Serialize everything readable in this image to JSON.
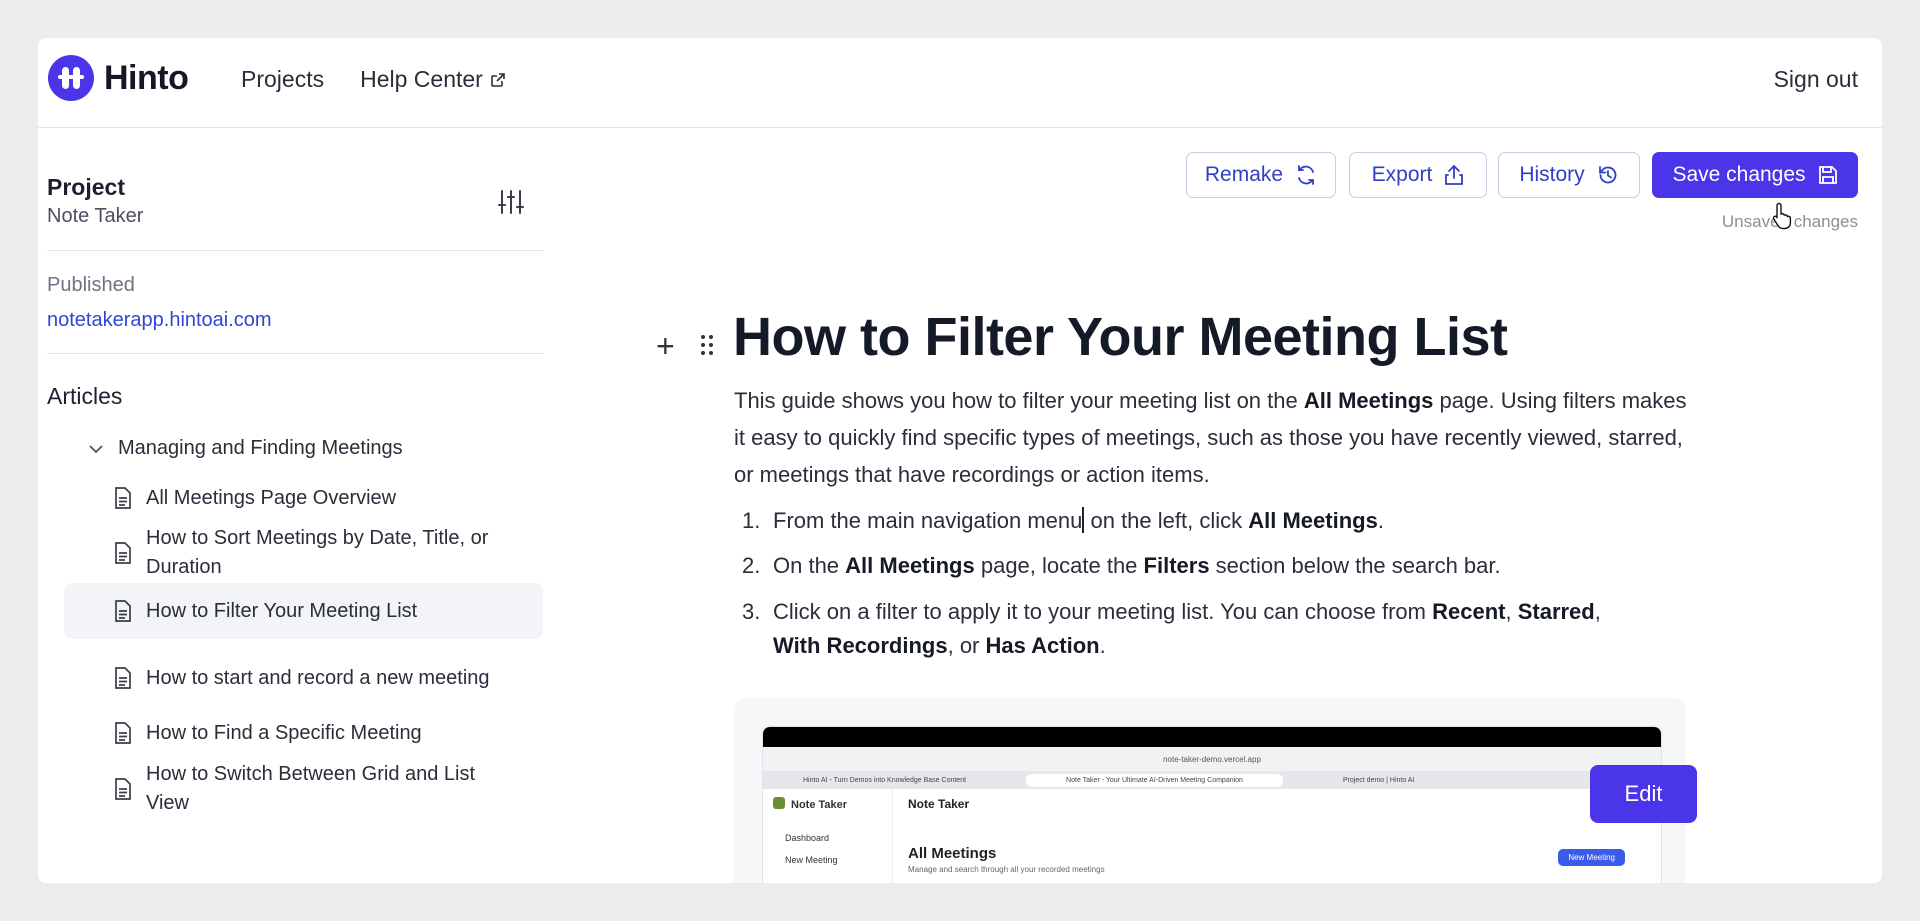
{
  "header": {
    "brand": "Hinto",
    "nav": [
      {
        "label": "Projects"
      },
      {
        "label": "Help Center",
        "external": true
      }
    ],
    "sign_out": "Sign out"
  },
  "sidebar": {
    "project_label": "Project",
    "project_name": "Note Taker",
    "published_label": "Published",
    "published_url": "notetakerapp.hintoai.com",
    "articles_label": "Articles",
    "group": {
      "label": "Managing and Finding Meetings",
      "expanded": true,
      "items": [
        {
          "label": "All Meetings Page Overview",
          "active": false
        },
        {
          "label": "How to Sort Meetings by Date, Title, or Duration",
          "active": false
        },
        {
          "label": "How to Filter Your Meeting List",
          "active": true
        },
        {
          "label": "How to start and record a new meeting",
          "active": false
        },
        {
          "label": "How to Find a Specific Meeting",
          "active": false
        },
        {
          "label": "How to Switch Between Grid and List View",
          "active": false
        }
      ]
    }
  },
  "toolbar": {
    "remake": "Remake",
    "export": "Export",
    "history": "History",
    "save": "Save changes",
    "status": "Unsaved changes"
  },
  "article": {
    "title": "How to Filter Your Meeting List",
    "intro_a": "This guide shows you how to filter your meeting list on the ",
    "intro_b": "All Meetings",
    "intro_c": " page. Using filters makes it easy to quickly find specific types of meetings, such as those you have recently viewed, starred, or meetings that have recordings or action items.",
    "steps": [
      {
        "num": "1.",
        "t1": "From the main navigation menu",
        "t2": " on the left, click ",
        "b1": "All Meetings",
        "t3": "."
      },
      {
        "num": "2.",
        "t1": "On the ",
        "b1": "All Meetings",
        "t2": " page, locate the ",
        "b2": "Filters",
        "t3": " section below the search bar."
      },
      {
        "num": "3.",
        "t1": "Click on a filter to apply it to your meeting list. You can choose from ",
        "b1": "Recent",
        "t2": ", ",
        "b2": "Starred",
        "t3": ", ",
        "b3": "With Recordings",
        "t4": ", or ",
        "b4": "Has Action",
        "t5": "."
      }
    ],
    "edit_button": "Edit"
  },
  "embedded_screenshot": {
    "url": "note-taker-demo.vercel.app",
    "tabs": [
      "Hinto AI - Turn Demos into Knowledge Base Content",
      "Note Taker - Your Ultimate AI-Driven Meeting Companion",
      "Project demo | Hinto AI"
    ],
    "app_name": "Note Taker",
    "nav": [
      "Dashboard",
      "New Meeting"
    ],
    "header_title": "Note Taker",
    "page_title": "All Meetings",
    "page_subtitle": "Manage and search through all your recorded meetings",
    "new_button": "New Meeting"
  },
  "colors": {
    "accent": "#4a36e8",
    "link": "#2f45d8",
    "active_row": "#f3f4f7"
  }
}
